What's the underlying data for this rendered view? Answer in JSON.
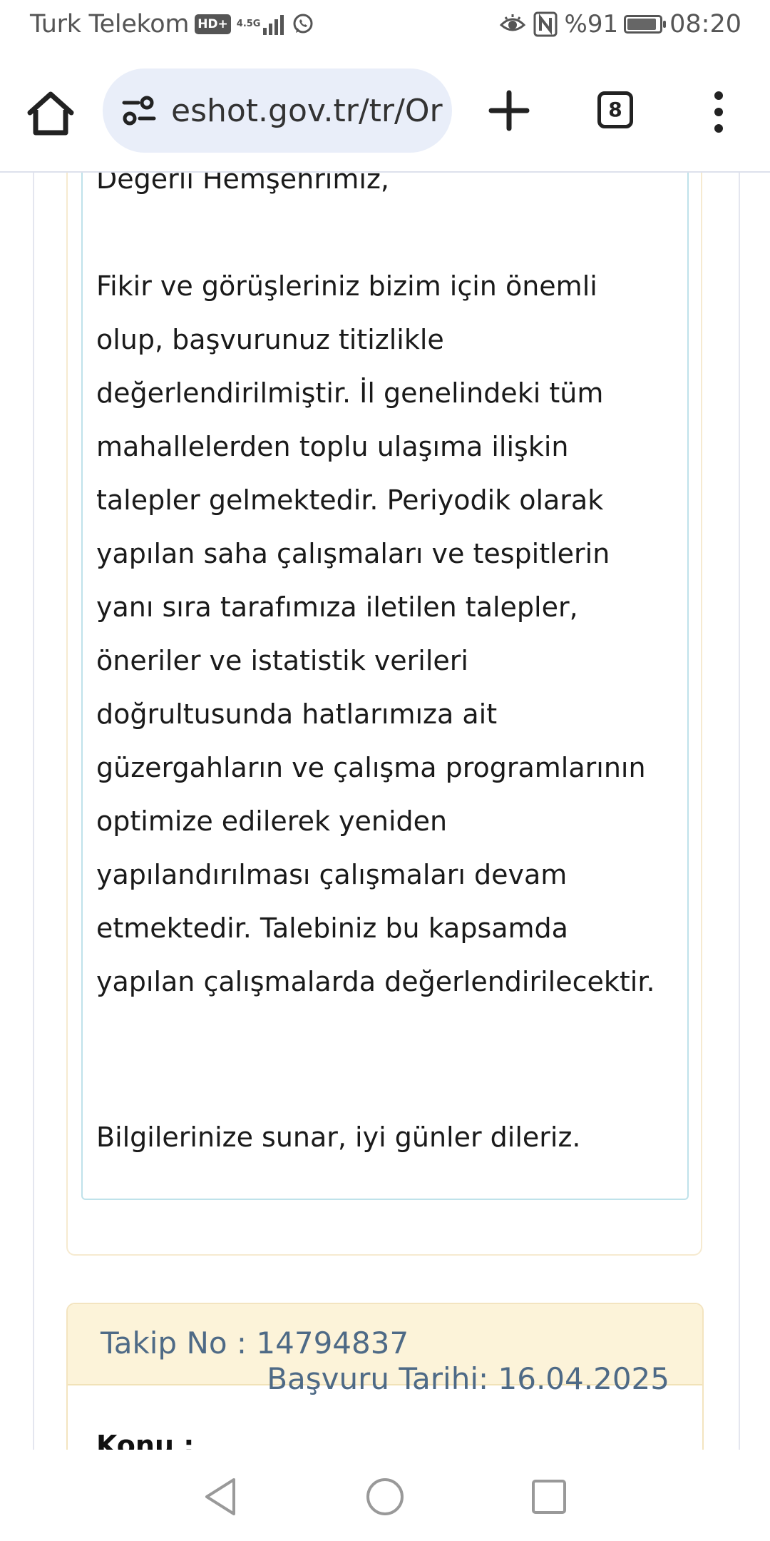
{
  "status_bar": {
    "carrier": "Turk Telekom",
    "hd_badge": "HD+",
    "network_label": "4.5G",
    "battery_percent": "%91",
    "time": "08:20",
    "battery_level": 0.91
  },
  "browser": {
    "url": "eshot.gov.tr/tr/Or",
    "tab_count": "8"
  },
  "answer": {
    "greeting": "Değerli Hemşehrimiz,",
    "body": "Fikir ve görüşleriniz bizim için önemli olup, başvurunuz titizlikle değerlendirilmiştir. İl genelindeki tüm mahallelerden toplu ulaşıma ilişkin talepler gelmektedir. Periyodik olarak yapılan saha çalışmaları ve tespitlerin yanı sıra tarafımıza iletilen talepler, öneriler ve istatistik verileri doğrultusunda hatlarımıza ait güzergahların ve çalışma programlarının optimize edilerek yeniden yapılandırılması çalışmaları devam etmektedir. Talebiniz bu kapsamda yapılan çalışmalarda değerlendirilecektir.",
    "closing": "Bilgilerinize sunar, iyi günler dileriz."
  },
  "application": {
    "tracking_no": "Takip No : 14794837",
    "application_date": "Başvuru Tarihi: 16.04.2025",
    "subject_label": "Konu :"
  },
  "colors": {
    "card_header_bg": "#fcf3d9",
    "card_text": "#4e6a86",
    "answer_border": "#bfe2ea",
    "url_bar_bg": "#e9eef9"
  }
}
